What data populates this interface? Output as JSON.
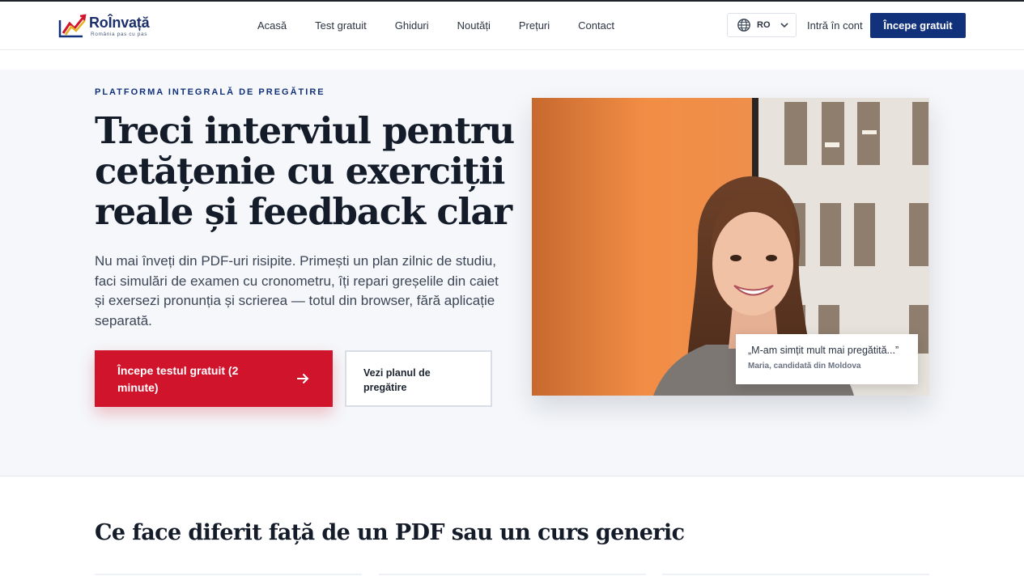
{
  "brand": {
    "name": "RoÎnvață",
    "tagline": "România pas cu pas",
    "colors": {
      "primary": "#12317b",
      "accent": "#d0142c",
      "hero_bg": "#f5f7fa"
    }
  },
  "nav": {
    "items": [
      "Acasă",
      "Test gratuit",
      "Ghiduri",
      "Noutăți",
      "Prețuri",
      "Contact"
    ]
  },
  "header": {
    "language_code": "RO",
    "login_label": "Intră în cont",
    "start_label": "Începe gratuit"
  },
  "hero": {
    "eyebrow": "PLATFORMA INTEGRALĂ DE PREGĂTIRE",
    "title": "Treci interviul pentru cetățenie cu exerciții reale și feedback clar",
    "lead": "Nu mai înveți din PDF-uri risipite. Primești un plan zilnic de studiu, faci simulări de examen cu cronometru, îți repari greșelile din caiet și exersezi pronunția și scrierea — totul din browser, fără aplicație separată.",
    "cta_primary": "Începe testul gratuit (2 minute)",
    "cta_secondary": "Vezi planul de pregătire",
    "testimonial": {
      "quote": "„M-am simțit mult mai pregătită...”",
      "author": "Maria, candidată din Moldova"
    }
  },
  "section": {
    "title": "Ce face diferit față de un PDF sau un curs generic"
  },
  "icons": [
    "logo-icon",
    "globe-icon",
    "chevron-down-icon",
    "arrow-right-icon"
  ]
}
